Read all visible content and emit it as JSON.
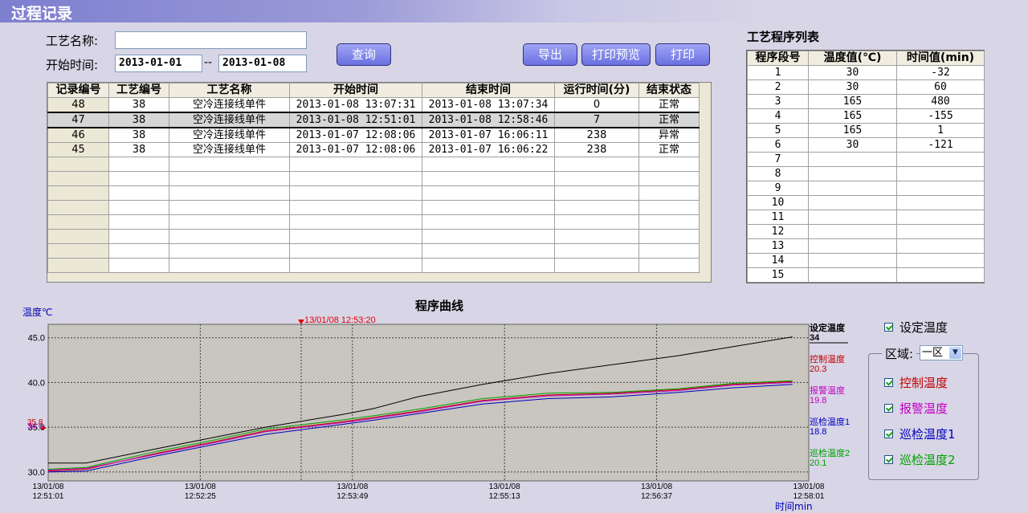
{
  "window": {
    "title": "过程记录"
  },
  "filters": {
    "name_label": "工艺名称:",
    "name_value": "",
    "time_label": "开始时间:",
    "date_from": "2013-01-01",
    "date_sep": "--",
    "date_to": "2013-01-08",
    "query_label": "查询"
  },
  "toolbar": {
    "export_label": "导出",
    "preview_label": "打印预览",
    "print_label": "打印"
  },
  "records": {
    "headers": [
      "记录编号",
      "工艺编号",
      "工艺名称",
      "开始时间",
      "结束时间",
      "运行时间(分)",
      "结束状态"
    ],
    "rows": [
      [
        "48",
        "38",
        "空冷连接线单件",
        "2013-01-08 13:07:31",
        "2013-01-08 13:07:34",
        "0",
        "正常"
      ],
      [
        "47",
        "38",
        "空冷连接线单件",
        "2013-01-08 12:51:01",
        "2013-01-08 12:58:46",
        "7",
        "正常"
      ],
      [
        "46",
        "38",
        "空冷连接线单件",
        "2013-01-07 12:08:06",
        "2013-01-07 16:06:11",
        "238",
        "异常"
      ],
      [
        "45",
        "38",
        "空冷连接线单件",
        "2013-01-07 12:08:06",
        "2013-01-07 16:06:22",
        "238",
        "正常"
      ]
    ],
    "selected_index": 1
  },
  "program": {
    "title": "工艺程序列表",
    "headers": [
      "程序段号",
      "温度值(℃)",
      "时间值(min)"
    ],
    "rows": [
      [
        "1",
        "30",
        "-32"
      ],
      [
        "2",
        "30",
        "60"
      ],
      [
        "3",
        "165",
        "480"
      ],
      [
        "4",
        "165",
        "-155"
      ],
      [
        "5",
        "165",
        "1"
      ],
      [
        "6",
        "30",
        "-121"
      ],
      [
        "7",
        "",
        ""
      ],
      [
        "8",
        "",
        ""
      ],
      [
        "9",
        "",
        ""
      ],
      [
        "10",
        "",
        ""
      ],
      [
        "11",
        "",
        ""
      ],
      [
        "12",
        "",
        ""
      ],
      [
        "13",
        "",
        ""
      ],
      [
        "14",
        "",
        ""
      ],
      [
        "15",
        "",
        ""
      ]
    ]
  },
  "chart_panel": {
    "title": "程序曲线",
    "ylabel": "温度℃",
    "xlabel": "时间min",
    "cursor_label": "13/01/08 12:53:20",
    "left_marker_values": [
      "35.8",
      "34.6"
    ],
    "legend": [
      {
        "name": "设定温度",
        "value": "34",
        "color": "#000000"
      },
      {
        "name": "控制温度",
        "value": "20.3",
        "color": "#c00000"
      },
      {
        "name": "报警温度",
        "value": "19.8",
        "color": "#c000c0"
      },
      {
        "name": "巡检温度1",
        "value": "18.8",
        "color": "#0000c0"
      },
      {
        "name": "巡检温度2",
        "value": "20.1",
        "color": "#00a000"
      }
    ]
  },
  "side": {
    "set_temp_label": "设定温度",
    "zone_label": "区域:",
    "zone_value": "一区",
    "checks": [
      "控制温度",
      "报警温度",
      "巡检温度1",
      "巡检温度2"
    ],
    "check_colors": [
      "#c00000",
      "#c000c0",
      "#0000c0",
      "#00a000"
    ]
  },
  "chart_data": {
    "type": "line",
    "ylim": [
      29,
      46.5
    ],
    "yticks": [
      "45.0",
      "40.0",
      "35.0",
      "30.0"
    ],
    "ytick_values": [
      45,
      40,
      35,
      30
    ],
    "xticks": [
      [
        "13/01/08",
        "12:51:01"
      ],
      [
        "13/01/08",
        "12:52:25"
      ],
      [
        "13/01/08",
        "12:53:49"
      ],
      [
        "13/01/08",
        "12:55:13"
      ],
      [
        "13/01/08",
        "12:56:37"
      ],
      [
        "13/01/08",
        "12:58:01"
      ]
    ],
    "xlim_min": [
      0,
      7
    ],
    "x": [
      0,
      0.35,
      1.0,
      1.5,
      2.0,
      2.7,
      3.0,
      3.4,
      4.0,
      4.6,
      5.2,
      5.8,
      6.3,
      6.85
    ],
    "series": [
      {
        "name": "设定温度",
        "color": "#000000",
        "values": [
          31.0,
          31.0,
          32.6,
          33.8,
          35.0,
          36.4,
          37.1,
          38.4,
          39.8,
          41.0,
          42.0,
          43.0,
          44.0,
          45.1
        ]
      },
      {
        "name": "控制温度",
        "color": "#c00000",
        "values": [
          30.1,
          30.3,
          32.1,
          33.3,
          34.6,
          35.6,
          36.1,
          36.8,
          38.0,
          38.6,
          38.8,
          39.2,
          39.8,
          40.1
        ]
      },
      {
        "name": "报警温度",
        "color": "#c000c0",
        "values": [
          30.2,
          30.4,
          32.0,
          33.2,
          34.5,
          35.5,
          36.0,
          36.7,
          37.9,
          38.5,
          38.7,
          39.1,
          39.7,
          40.0
        ]
      },
      {
        "name": "巡检温度1",
        "color": "#0000c0",
        "values": [
          30.0,
          30.1,
          31.8,
          33.0,
          34.2,
          35.3,
          35.8,
          36.5,
          37.6,
          38.2,
          38.4,
          38.9,
          39.4,
          39.8
        ]
      },
      {
        "name": "巡检温度2",
        "color": "#00a000",
        "values": [
          30.3,
          30.5,
          32.3,
          33.5,
          34.8,
          35.8,
          36.3,
          37.0,
          38.2,
          38.8,
          38.9,
          39.3,
          39.9,
          40.2
        ]
      }
    ]
  }
}
